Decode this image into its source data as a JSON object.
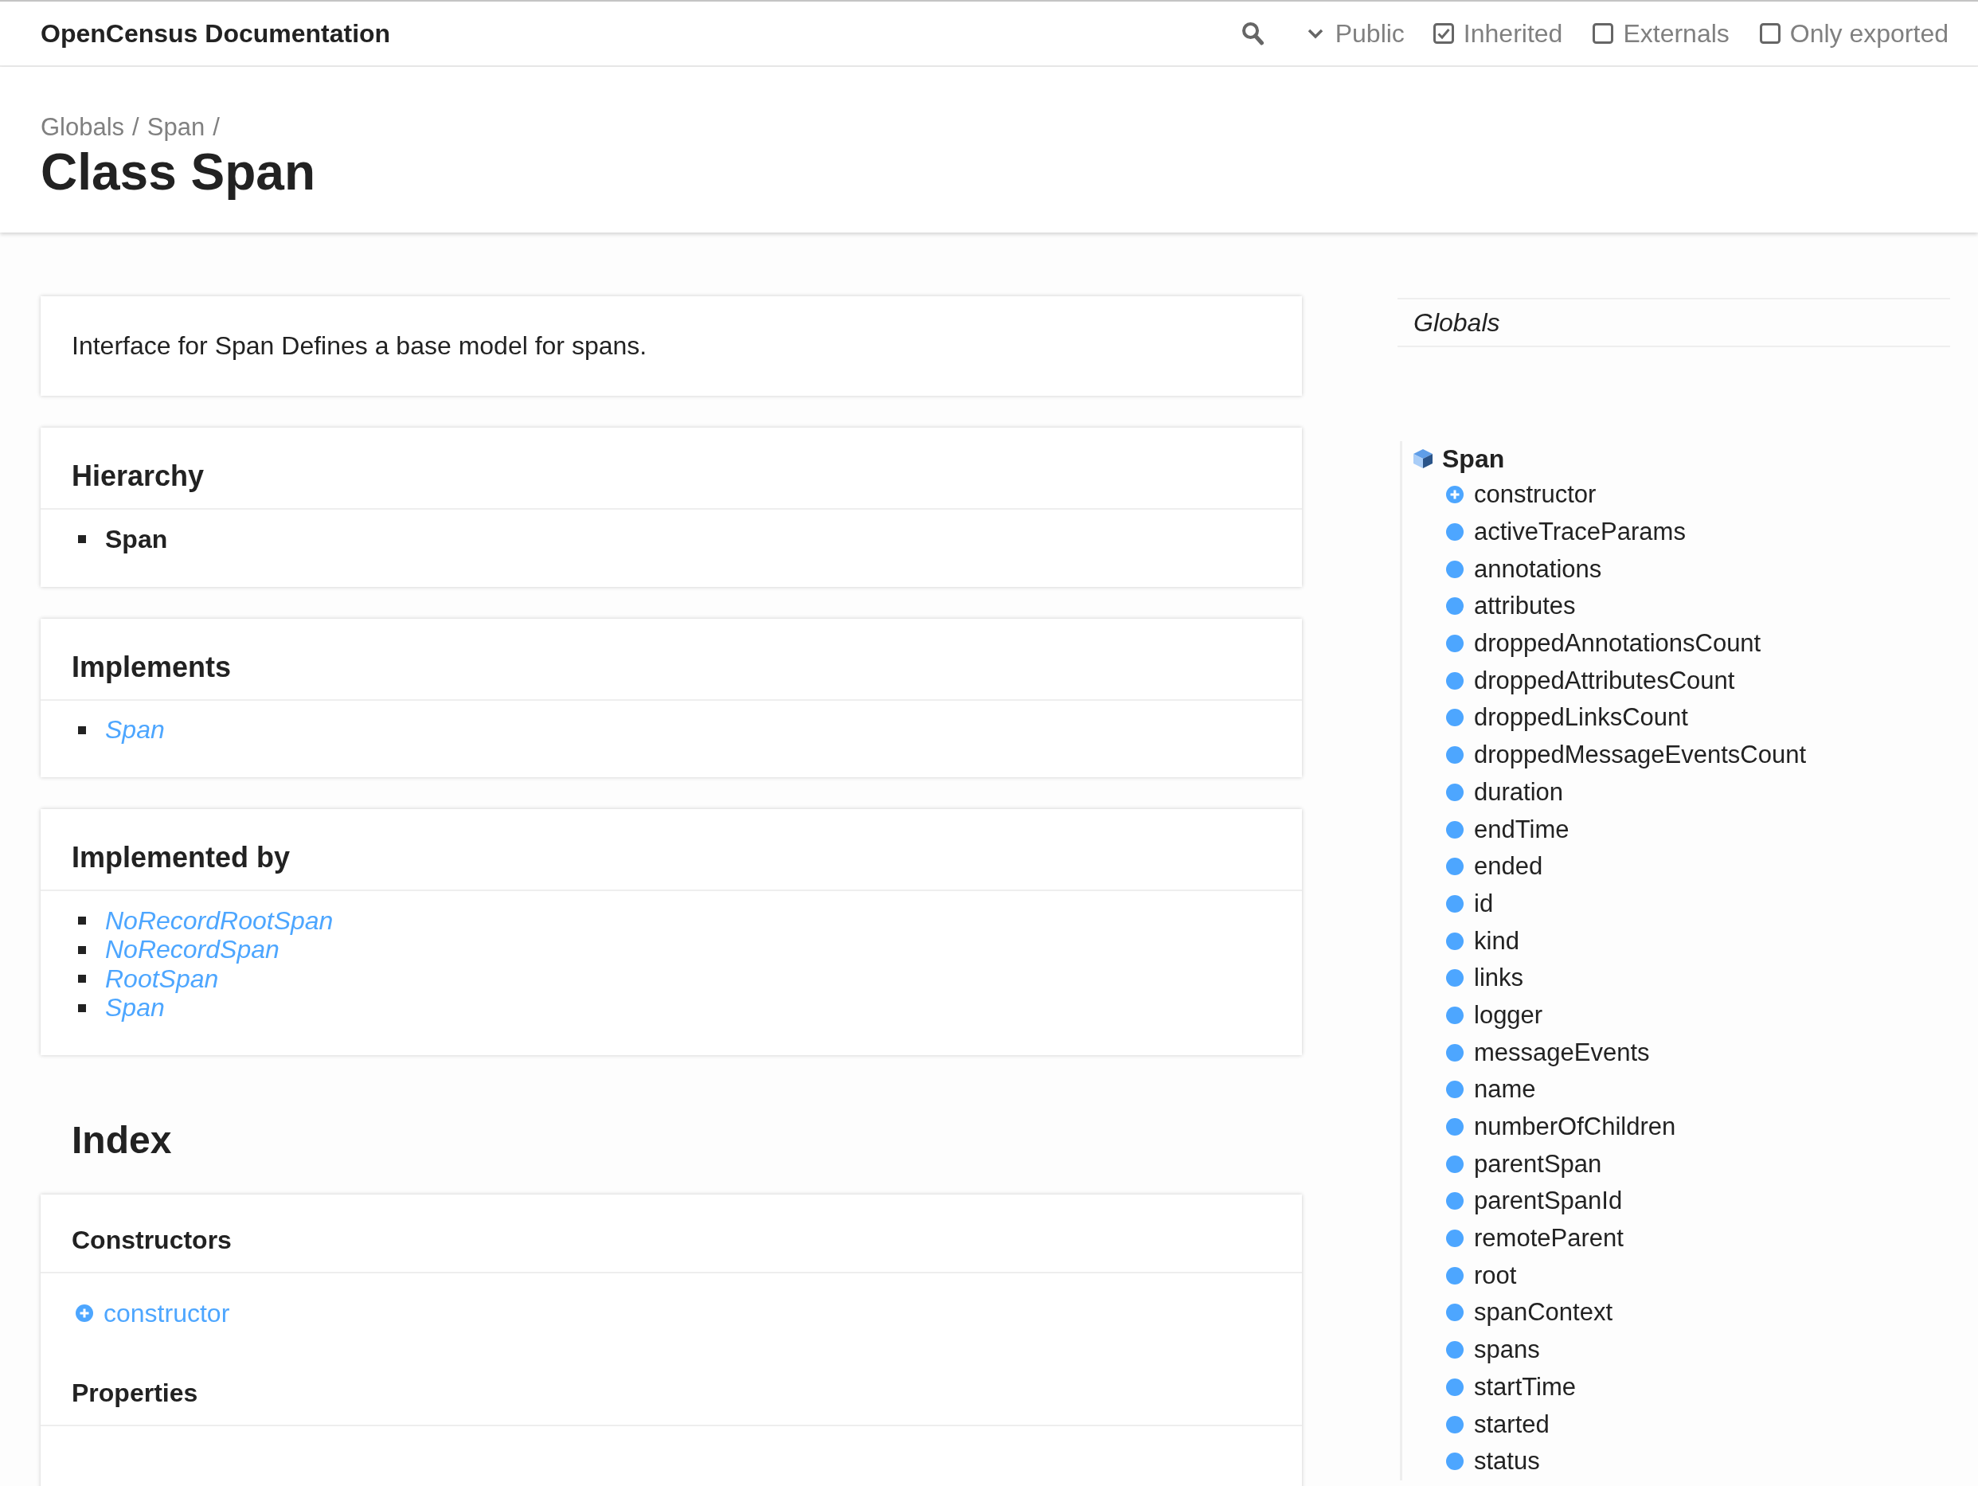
{
  "toolbar": {
    "title": "OpenCensus Documentation",
    "visibility": "Public",
    "filters": [
      {
        "label": "Inherited",
        "checked": true
      },
      {
        "label": "Externals",
        "checked": false
      },
      {
        "label": "Only exported",
        "checked": false
      }
    ]
  },
  "header": {
    "breadcrumb": [
      {
        "label": "Globals",
        "separator": "/"
      },
      {
        "label": "Span",
        "separator": "/"
      }
    ],
    "title": "Class Span"
  },
  "sections": [
    {
      "kind": "text",
      "text": "Interface for Span Defines a base model for spans."
    },
    {
      "kind": "list",
      "title": "Hierarchy",
      "items": [
        {
          "label": "Span",
          "kind": "current"
        }
      ]
    },
    {
      "kind": "list",
      "title": "Implements",
      "items": [
        {
          "label": "Span",
          "kind": "link"
        }
      ]
    },
    {
      "kind": "list",
      "title": "Implemented by",
      "items": [
        {
          "label": "NoRecordRootSpan",
          "kind": "link"
        },
        {
          "label": "NoRecordSpan",
          "kind": "link"
        },
        {
          "label": "RootSpan",
          "kind": "link"
        },
        {
          "label": "Span",
          "kind": "link"
        }
      ]
    }
  ],
  "index": {
    "title": "Index",
    "groups": [
      {
        "title": "Constructors",
        "items": [
          {
            "label": "constructor",
            "kind": "constructor"
          }
        ]
      },
      {
        "title": "Properties"
      }
    ]
  },
  "sidebar": {
    "globals": "Globals",
    "class_name": "Span",
    "items": [
      {
        "label": "constructor",
        "kind": "constructor"
      },
      {
        "label": "activeTraceParams",
        "kind": "property"
      },
      {
        "label": "annotations",
        "kind": "property"
      },
      {
        "label": "attributes",
        "kind": "property"
      },
      {
        "label": "droppedAnnotationsCount",
        "kind": "property"
      },
      {
        "label": "droppedAttributesCount",
        "kind": "property"
      },
      {
        "label": "droppedLinksCount",
        "kind": "property"
      },
      {
        "label": "droppedMessageEventsCount",
        "kind": "property"
      },
      {
        "label": "duration",
        "kind": "property"
      },
      {
        "label": "endTime",
        "kind": "property"
      },
      {
        "label": "ended",
        "kind": "property"
      },
      {
        "label": "id",
        "kind": "property"
      },
      {
        "label": "kind",
        "kind": "property"
      },
      {
        "label": "links",
        "kind": "property"
      },
      {
        "label": "logger",
        "kind": "property"
      },
      {
        "label": "messageEvents",
        "kind": "property"
      },
      {
        "label": "name",
        "kind": "property"
      },
      {
        "label": "numberOfChildren",
        "kind": "property"
      },
      {
        "label": "parentSpan",
        "kind": "property"
      },
      {
        "label": "parentSpanId",
        "kind": "property"
      },
      {
        "label": "remoteParent",
        "kind": "property"
      },
      {
        "label": "root",
        "kind": "property"
      },
      {
        "label": "spanContext",
        "kind": "property"
      },
      {
        "label": "spans",
        "kind": "property"
      },
      {
        "label": "startTime",
        "kind": "property"
      },
      {
        "label": "started",
        "kind": "property"
      },
      {
        "label": "status",
        "kind": "property"
      }
    ]
  }
}
